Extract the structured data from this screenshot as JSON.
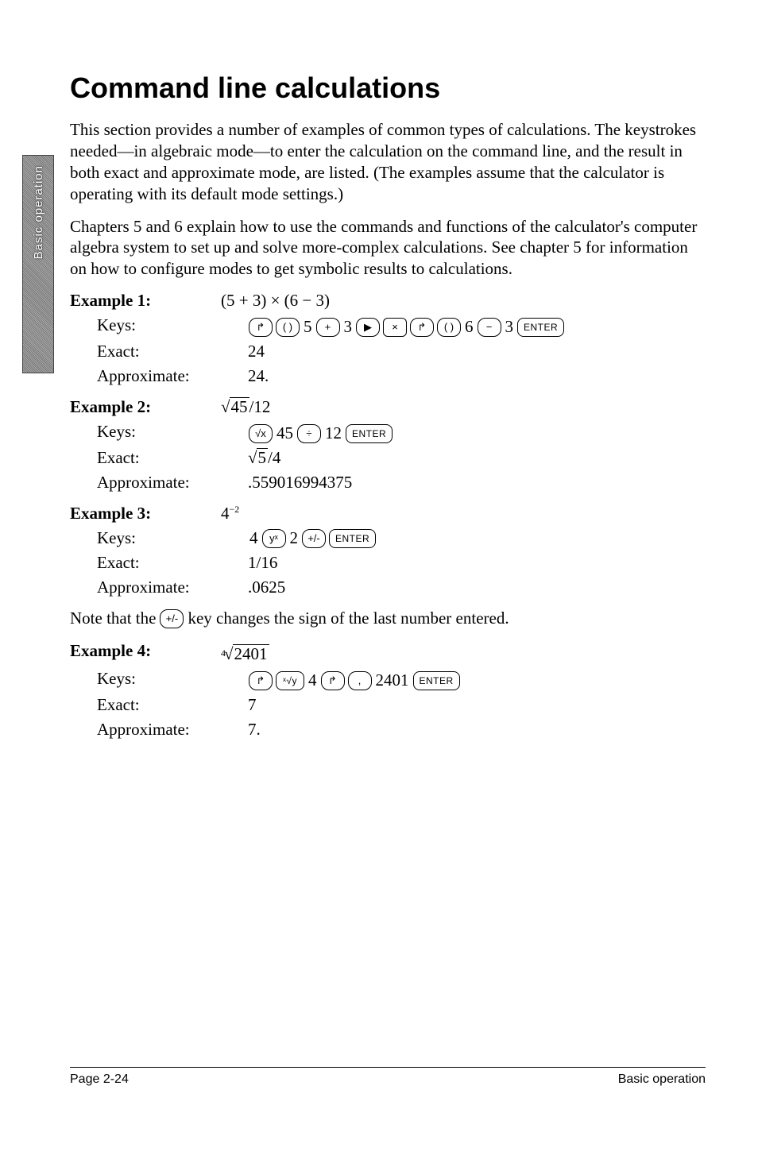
{
  "sidetab": "Basic operation",
  "title": "Command line calculations",
  "intro": [
    "This section provides a number of examples of common types of calculations. The keystrokes needed—in algebraic mode—to enter the calculation on the command line, and the result in both exact and approximate mode, are listed. (The examples assume that the calculator is operating with its default mode settings.)",
    "Chapters 5 and 6 explain how to use the commands and functions of the calculator's computer algebra system to set up and solve more-complex calculations. See chapter 5 for information on how to configure modes to get symbolic results to calculations."
  ],
  "row_labels": {
    "keys": "Keys:",
    "exact": "Exact:",
    "approx": "Approximate:"
  },
  "examples": [
    {
      "label": "Example 1:",
      "expr_plain": "(5 + 3) × (6 − 3)",
      "keys": [
        {
          "t": "key",
          "v": "↱"
        },
        {
          "t": "key",
          "v": "( )"
        },
        {
          "t": "tok",
          "v": "5"
        },
        {
          "t": "key",
          "v": "+"
        },
        {
          "t": "tok",
          "v": "3"
        },
        {
          "t": "key",
          "v": "▶"
        },
        {
          "t": "key",
          "v": "×",
          "cls": "square"
        },
        {
          "t": "key",
          "v": "↱"
        },
        {
          "t": "key",
          "v": "( )"
        },
        {
          "t": "tok",
          "v": "6"
        },
        {
          "t": "key",
          "v": "−"
        },
        {
          "t": "tok",
          "v": "3"
        },
        {
          "t": "key",
          "v": "ENTER",
          "cls": "wide"
        }
      ],
      "exact": "24",
      "approx": "24."
    },
    {
      "label": "Example 2:",
      "expr_sqrt": {
        "rad": "45"
      },
      "expr_after": "/12",
      "keys": [
        {
          "t": "key",
          "v": "√x"
        },
        {
          "t": "tok",
          "v": "45"
        },
        {
          "t": "key",
          "v": "÷"
        },
        {
          "t": "tok",
          "v": "12"
        },
        {
          "t": "key",
          "v": "ENTER",
          "cls": "wide"
        }
      ],
      "exact_sqrt": {
        "rad": "5"
      },
      "exact_after": "/4",
      "approx": ".559016994375"
    },
    {
      "label": "Example 3:",
      "expr_html": "4<sup>−2</sup>",
      "keys": [
        {
          "t": "tok",
          "v": "4"
        },
        {
          "t": "key",
          "v": "yˣ"
        },
        {
          "t": "tok",
          "v": "2"
        },
        {
          "t": "key",
          "v": "+/-"
        },
        {
          "t": "key",
          "v": "ENTER",
          "cls": "wide"
        }
      ],
      "exact": "1/16",
      "approx": ".0625"
    },
    {
      "label": "Example 4:",
      "expr_sqrt": {
        "index": "4",
        "rad": "2401"
      },
      "keys": [
        {
          "t": "key",
          "v": "↱"
        },
        {
          "t": "key",
          "v": "ˣ√y",
          "cls": "wide"
        },
        {
          "t": "tok",
          "v": "4"
        },
        {
          "t": "key",
          "v": "↱"
        },
        {
          "t": "key",
          "v": ","
        },
        {
          "t": "tok",
          "v": "2401"
        },
        {
          "t": "key",
          "v": "ENTER",
          "cls": "wide"
        }
      ],
      "exact": "7",
      "approx": "7."
    }
  ],
  "note_before": "Note that the",
  "note_key": "+/-",
  "note_after": "key changes the sign of the last number entered.",
  "footer": {
    "left": "Page 2-24",
    "right": "Basic operation"
  }
}
